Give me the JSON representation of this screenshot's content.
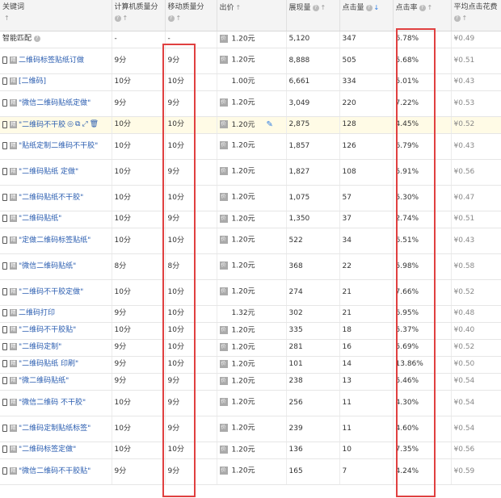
{
  "headers": [
    {
      "label": "关键词",
      "has_q": false,
      "sort": "↑",
      "active": false
    },
    {
      "label": "计算机质量分",
      "has_q": true,
      "sort": "↑",
      "active": false
    },
    {
      "label": "移动质量分",
      "has_q": true,
      "sort": "↑",
      "active": false
    },
    {
      "label": "出价",
      "has_q": false,
      "sort": "↑",
      "active": false
    },
    {
      "label": "展现量",
      "has_q": true,
      "sort": "↑",
      "active": false
    },
    {
      "label": "点击量",
      "has_q": true,
      "sort": "↓",
      "active": true
    },
    {
      "label": "点击率",
      "has_q": true,
      "sort": "↑",
      "active": false
    },
    {
      "label": "平均点击花费",
      "has_q": true,
      "sort": "↑",
      "active": false
    }
  ],
  "rows": [
    {
      "kw": "智能匹配",
      "special": true,
      "pc": "-",
      "mob": "-",
      "bid": "1.20元",
      "imp": "5,120",
      "clicks": "347",
      "ctr": "6.78%",
      "cpc": "¥0.49"
    },
    {
      "kw": "二维码标签贴纸订做",
      "pc": "9分",
      "mob": "9分",
      "bid": "1.20元",
      "imp": "8,888",
      "clicks": "505",
      "ctr": "5.68%",
      "cpc": "¥0.51"
    },
    {
      "kw": "[二维码]",
      "pc": "10分",
      "mob": "10分",
      "bid": "1.00元",
      "imp": "6,661",
      "clicks": "334",
      "ctr": "5.01%",
      "cpc": "¥0.43",
      "nobidbox": true
    },
    {
      "kw": "\"微信二维码贴纸定做\"",
      "pc": "9分",
      "mob": "9分",
      "bid": "1.20元",
      "imp": "3,049",
      "clicks": "220",
      "ctr": "7.22%",
      "cpc": "¥0.53"
    },
    {
      "kw": "\"二维码不干胶",
      "pc": "10分",
      "mob": "10分",
      "bid": "1.20元",
      "imp": "2,875",
      "clicks": "128",
      "ctr": "4.45%",
      "cpc": "¥0.52",
      "highlight": true
    },
    {
      "kw": "\"贴纸定制二维码不干胶\"",
      "pc": "10分",
      "mob": "10分",
      "bid": "1.20元",
      "imp": "1,857",
      "clicks": "126",
      "ctr": "6.79%",
      "cpc": "¥0.43"
    },
    {
      "kw": "\"二维码贴纸 定做\"",
      "pc": "10分",
      "mob": "9分",
      "bid": "1.20元",
      "imp": "1,827",
      "clicks": "108",
      "ctr": "5.91%",
      "cpc": "¥0.56"
    },
    {
      "kw": "\"二维码贴纸不干胶\"",
      "pc": "10分",
      "mob": "10分",
      "bid": "1.20元",
      "imp": "1,075",
      "clicks": "57",
      "ctr": "5.30%",
      "cpc": "¥0.47"
    },
    {
      "kw": "\"二维码贴纸\"",
      "pc": "10分",
      "mob": "9分",
      "bid": "1.20元",
      "imp": "1,350",
      "clicks": "37",
      "ctr": "2.74%",
      "cpc": "¥0.51"
    },
    {
      "kw": "\"定做二维码标签贴纸\"",
      "pc": "10分",
      "mob": "10分",
      "bid": "1.20元",
      "imp": "522",
      "clicks": "34",
      "ctr": "6.51%",
      "cpc": "¥0.43"
    },
    {
      "kw": "\"微信二维码贴纸\"",
      "pc": "8分",
      "mob": "8分",
      "bid": "1.20元",
      "imp": "368",
      "clicks": "22",
      "ctr": "5.98%",
      "cpc": "¥0.58"
    },
    {
      "kw": "\"二维码不干胶定做\"",
      "pc": "10分",
      "mob": "10分",
      "bid": "1.20元",
      "imp": "274",
      "clicks": "21",
      "ctr": "7.66%",
      "cpc": "¥0.52"
    },
    {
      "kw": "二维码打印",
      "pc": "9分",
      "mob": "10分",
      "bid": "1.32元",
      "imp": "302",
      "clicks": "21",
      "ctr": "6.95%",
      "cpc": "¥0.48",
      "nobidbox": true
    },
    {
      "kw": "\"二维码不干胶贴\"",
      "pc": "10分",
      "mob": "10分",
      "bid": "1.20元",
      "imp": "335",
      "clicks": "18",
      "ctr": "5.37%",
      "cpc": "¥0.40"
    },
    {
      "kw": "\"二维码定制\"",
      "pc": "9分",
      "mob": "10分",
      "bid": "1.20元",
      "imp": "281",
      "clicks": "16",
      "ctr": "5.69%",
      "cpc": "¥0.52"
    },
    {
      "kw": "\"二维码贴纸 印刷\"",
      "pc": "9分",
      "mob": "10分",
      "bid": "1.20元",
      "imp": "101",
      "clicks": "14",
      "ctr": "13.86%",
      "cpc": "¥0.50"
    },
    {
      "kw": "\"微二维码贴纸\"",
      "pc": "9分",
      "mob": "9分",
      "bid": "1.20元",
      "imp": "238",
      "clicks": "13",
      "ctr": "5.46%",
      "cpc": "¥0.54"
    },
    {
      "kw": "\"微信二维码 不干胶\"",
      "pc": "10分",
      "mob": "9分",
      "bid": "1.20元",
      "imp": "256",
      "clicks": "11",
      "ctr": "4.30%",
      "cpc": "¥0.54"
    },
    {
      "kw": "\"二维码定制贴纸标签\"",
      "pc": "10分",
      "mob": "9分",
      "bid": "1.20元",
      "imp": "239",
      "clicks": "11",
      "ctr": "4.60%",
      "cpc": "¥0.54"
    },
    {
      "kw": "\"二维码标签定做\"",
      "pc": "10分",
      "mob": "10分",
      "bid": "1.20元",
      "imp": "136",
      "clicks": "10",
      "ctr": "7.35%",
      "cpc": "¥0.56"
    },
    {
      "kw": "\"微信二维码不干胶贴\"",
      "pc": "9分",
      "mob": "9分",
      "bid": "1.20元",
      "imp": "165",
      "clicks": "7",
      "ctr": "4.24%",
      "cpc": "¥0.59"
    }
  ],
  "colors": {
    "highlight_box": "#e04040",
    "sort_active": "#2a7ae2",
    "keyword_link": "#2a5db0"
  },
  "icons": {
    "question": "question-circle-icon",
    "device": "mobile-device-icon",
    "match_type": "match-type-icon",
    "bid": "bid-icon",
    "edit": "pencil-icon"
  },
  "labels": {
    "q": "?",
    "match_type": "精",
    "bid_box": "价",
    "pencil": "✎",
    "row_tools": [
      "◎",
      "⧉",
      "⤢",
      "🗑"
    ]
  },
  "watermark": " "
}
